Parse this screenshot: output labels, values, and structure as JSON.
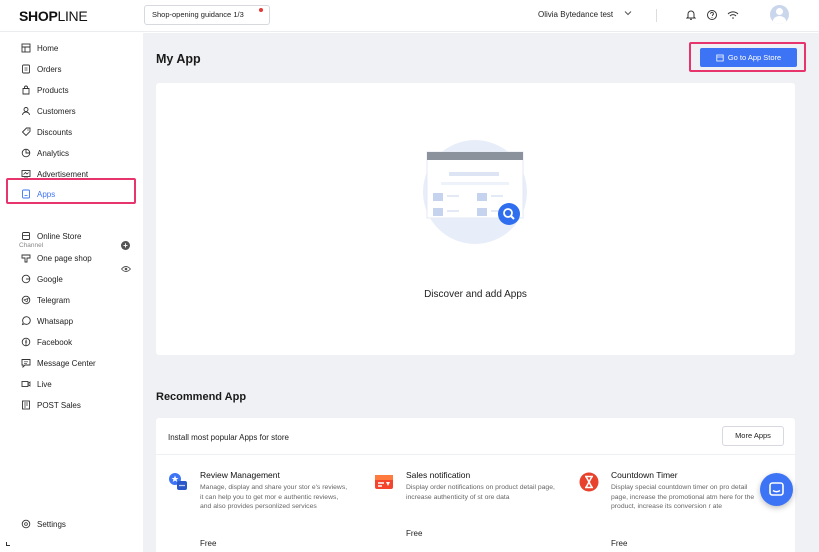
{
  "header": {
    "logo_bold": "SHOP",
    "logo_thin": "LINE",
    "guide_label": "Shop-opening guidance 1/3",
    "user_name": "Olivia Bytedance test"
  },
  "sidebar": {
    "items": [
      {
        "label": "Home",
        "icon": "home-icon"
      },
      {
        "label": "Orders",
        "icon": "orders-icon"
      },
      {
        "label": "Products",
        "icon": "products-icon"
      },
      {
        "label": "Customers",
        "icon": "customers-icon"
      },
      {
        "label": "Discounts",
        "icon": "discounts-icon"
      },
      {
        "label": "Analytics",
        "icon": "analytics-icon"
      },
      {
        "label": "Advertisement",
        "icon": "advertisement-icon"
      },
      {
        "label": "Apps",
        "icon": "apps-icon"
      }
    ],
    "channel_label": "Channel",
    "channels": [
      {
        "label": "Online Store",
        "icon": "online-store-icon"
      },
      {
        "label": "One page shop",
        "icon": "one-page-shop-icon"
      },
      {
        "label": "Google",
        "icon": "google-icon"
      },
      {
        "label": "Telegram",
        "icon": "telegram-icon"
      },
      {
        "label": "Whatsapp",
        "icon": "whatsapp-icon"
      },
      {
        "label": "Facebook",
        "icon": "facebook-icon"
      },
      {
        "label": "Message Center",
        "icon": "message-center-icon"
      },
      {
        "label": "Live",
        "icon": "live-icon"
      },
      {
        "label": "POST Sales",
        "icon": "pos-icon"
      }
    ],
    "settings_label": "Settings"
  },
  "main": {
    "title": "My App",
    "app_store_button": "Go to App Store",
    "empty_text": "Discover and add Apps",
    "recommend_title": "Recommend App",
    "recommend_head": "Install most popular Apps for store",
    "more_apps": "More Apps",
    "apps": [
      {
        "name": "Review Management",
        "description": "Manage, display and share your stor e's reviews, it can help you to get mor e authentic reviews, and also provides personlized services",
        "price": "Free",
        "icon": "review-management-icon"
      },
      {
        "name": "Sales notification",
        "description": "Display order notifications on product detail page, increase authenticity of st ore data",
        "price": "Free",
        "icon": "sales-notification-icon"
      },
      {
        "name": "Countdown Timer",
        "description": "Display special countdown timer on pro detail page, increase the promotional atm here for the product, increase its conversion r ate",
        "price": "Free",
        "icon": "countdown-timer-icon"
      }
    ]
  },
  "colors": {
    "accent": "#3d73f5",
    "highlight": "#e8346c",
    "background": "#eff1f4"
  }
}
